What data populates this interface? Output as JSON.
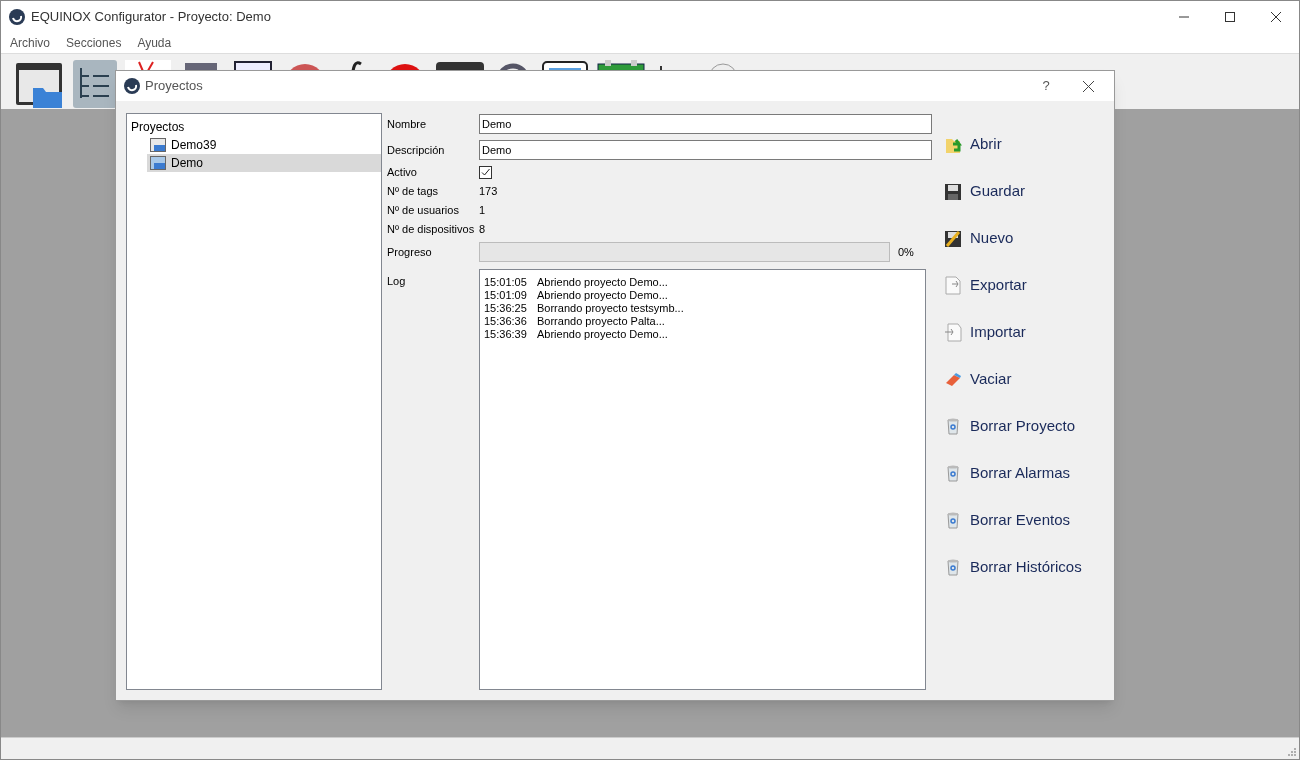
{
  "window": {
    "title": "EQUINOX Configurator - Proyecto: Demo"
  },
  "menu": [
    "Archivo",
    "Secciones",
    "Ayuda"
  ],
  "dialog": {
    "title": "Proyectos",
    "help": "?",
    "tree": {
      "label": "Proyectos",
      "children": [
        {
          "label": "Demo39",
          "selected": false
        },
        {
          "label": "Demo",
          "selected": true
        }
      ]
    },
    "form": {
      "nombre": {
        "label": "Nombre",
        "value": "Demo"
      },
      "descripcion": {
        "label": "Descripción",
        "value": "Demo"
      },
      "activo": {
        "label": "Activo",
        "checked": true
      },
      "stats": [
        {
          "label": "Nº de tags",
          "value": "173"
        },
        {
          "label": "Nº de usuarios",
          "value": "1"
        },
        {
          "label": "Nº de dispositivos",
          "value": "8"
        }
      ],
      "progress": {
        "label": "Progreso",
        "level": 0,
        "reading": "0%"
      },
      "log": {
        "label": "Log",
        "entries": [
          {
            "time": "15:01:05",
            "message": "Abriendo proyecto Demo..."
          },
          {
            "time": "15:01:09",
            "message": "Abriendo proyecto Demo..."
          },
          {
            "time": "15:36:25",
            "message": "Borrando proyecto testsymb..."
          },
          {
            "time": "15:36:36",
            "message": "Borrando proyecto Palta..."
          },
          {
            "time": "15:36:39",
            "message": "Abriendo proyecto Demo..."
          }
        ]
      }
    },
    "actions": [
      {
        "kind": "open",
        "label": "Abrir"
      },
      {
        "kind": "save",
        "label": "Guardar"
      },
      {
        "kind": "new",
        "label": "Nuevo"
      },
      {
        "kind": "export",
        "label": "Exportar"
      },
      {
        "kind": "import",
        "label": "Importar"
      },
      {
        "kind": "clear",
        "label": "Vaciar"
      },
      {
        "kind": "delete",
        "label": "Borrar Proyecto"
      },
      {
        "kind": "delete",
        "label": "Borrar Alarmas"
      },
      {
        "kind": "delete",
        "label": "Borrar Eventos"
      },
      {
        "kind": "delete",
        "label": "Borrar Históricos"
      }
    ]
  }
}
